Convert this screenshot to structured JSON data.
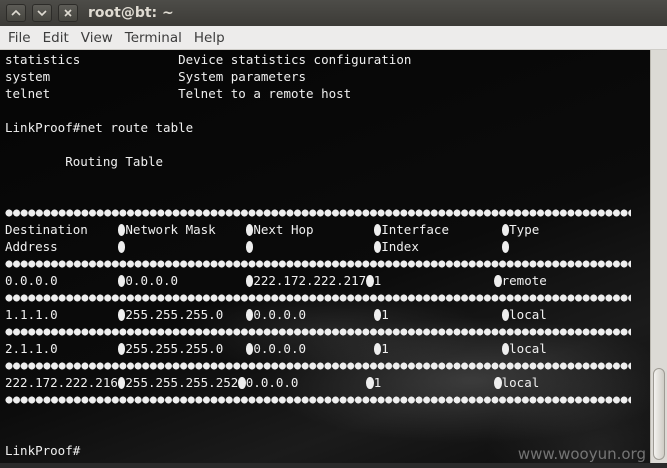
{
  "window": {
    "title": "root@bt: ~",
    "buttons": {
      "minimize": "^",
      "maximize": "v",
      "close": "x"
    }
  },
  "menu": [
    "File",
    "Edit",
    "View",
    "Terminal",
    "Help"
  ],
  "terminal": {
    "lines": [
      "statistics             Device statistics configuration",
      "system                 System parameters",
      "telnet                 Telnet to a remote host",
      "",
      "LinkProof#net route table",
      "",
      "        Routing Table",
      "",
      ""
    ],
    "table_header": [
      [
        "Destination    ",
        "Network Mask    ",
        "Next Hop        ",
        "Interface       ",
        "Type"
      ],
      [
        "Address        ",
        "                ",
        "                ",
        "Index           ",
        ""
      ]
    ],
    "table_rows": [
      [
        "0.0.0.0        ",
        "0.0.0.0         ",
        "222.172.222.217",
        "1               ",
        "remote"
      ],
      [
        "1.1.1.0        ",
        "255.255.255.0   ",
        "0.0.0.0         ",
        "1               ",
        "local"
      ],
      [
        "2.1.1.0        ",
        "255.255.255.0   ",
        "0.0.0.0         ",
        "1               ",
        "local"
      ],
      [
        "222.172.222.216",
        "255.255.255.252",
        "0.0.0.0         ",
        "1               ",
        "local"
      ]
    ],
    "prompt": "LinkProof#"
  },
  "watermark": "www.wooyun.org"
}
